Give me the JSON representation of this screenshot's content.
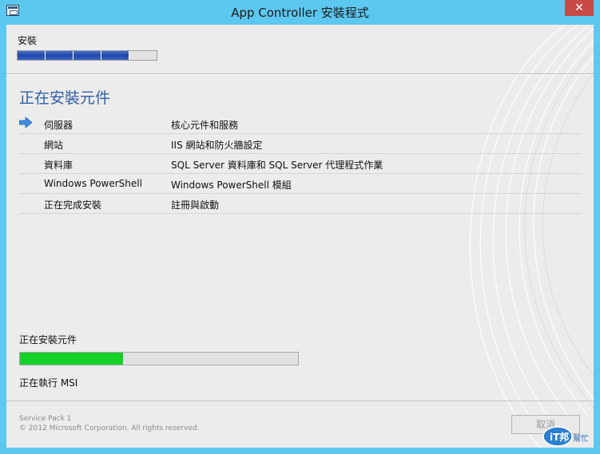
{
  "window": {
    "title": "App Controller 安裝程式",
    "close_glyph": "✕"
  },
  "stages": {
    "label": "安裝",
    "completed": 4,
    "total": 5
  },
  "main": {
    "heading": "正在安裝元件",
    "components": [
      {
        "name": "伺服器",
        "desc": "核心元件和服務",
        "current": true
      },
      {
        "name": "網站",
        "desc": "IIS 網站和防火牆設定",
        "current": false
      },
      {
        "name": "資料庫",
        "desc": "SQL Server 資料庫和 SQL Server 代理程式作業",
        "current": false
      },
      {
        "name": "Windows PowerShell",
        "desc": "Windows PowerShell 模組",
        "current": false
      },
      {
        "name": "正在完成安裝",
        "desc": "註冊與啟動",
        "current": false
      }
    ]
  },
  "progress": {
    "label": "正在安裝元件",
    "fraction": 0.37,
    "detail": "正在執行 MSI"
  },
  "footer": {
    "line1": "Service Pack 1",
    "line2": "© 2012 Microsoft Corporation. All rights reserved.",
    "cancel_label": "取消"
  },
  "colors": {
    "titlebar": "#5cc7ef",
    "heading": "#2f5fa6",
    "progress_fill": "#16d12a",
    "close_button": "#c74a47"
  },
  "icons": {
    "app": "installer-window-icon",
    "current_step": "right-arrow-icon"
  },
  "watermark": {
    "text": "iT邦幫忙"
  }
}
